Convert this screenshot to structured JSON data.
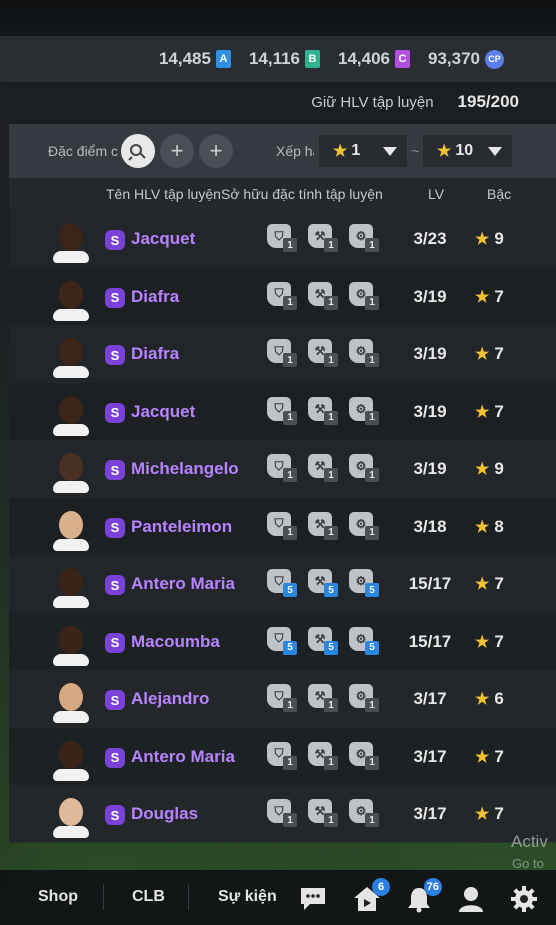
{
  "currencies": [
    {
      "value": "14,485",
      "letter": "A",
      "color": "#2f8fe0"
    },
    {
      "value": "14,116",
      "letter": "B",
      "color": "#2db38f"
    },
    {
      "value": "14,406",
      "letter": "C",
      "color": "#b14fe0"
    },
    {
      "value": "93,370",
      "letter": "CP",
      "color": "#5a7fe8"
    }
  ],
  "keep": {
    "label": "Giữ HLV tập luyện",
    "value": "195/200"
  },
  "filter": {
    "trait_label": "Đặc điểm c",
    "sort_label": "Xếp hạ",
    "min_star": "1",
    "max_star": "10",
    "add_glyph": "+"
  },
  "columns": {
    "name": "Tên HLV tập luyện",
    "traits": "Sở hữu đặc tính tập luyện",
    "lv": "LV",
    "grade": "Bậc"
  },
  "coaches": [
    {
      "name": "Jacquet",
      "lv": "3/23",
      "grade": "9",
      "skin": "#3b2418",
      "trait_levels": [
        "1",
        "1",
        "1"
      ],
      "blue": false
    },
    {
      "name": "Diafra",
      "lv": "3/19",
      "grade": "7",
      "skin": "#3d2519",
      "trait_levels": [
        "1",
        "1",
        "1"
      ],
      "blue": false
    },
    {
      "name": "Diafra",
      "lv": "3/19",
      "grade": "7",
      "skin": "#3d2519",
      "trait_levels": [
        "1",
        "1",
        "1"
      ],
      "blue": false
    },
    {
      "name": "Jacquet",
      "lv": "3/19",
      "grade": "7",
      "skin": "#3b2418",
      "trait_levels": [
        "1",
        "1",
        "1"
      ],
      "blue": false
    },
    {
      "name": "Michelangelo",
      "lv": "3/19",
      "grade": "9",
      "skin": "#4a3022",
      "trait_levels": [
        "1",
        "1",
        "1"
      ],
      "blue": false
    },
    {
      "name": "Panteleimon",
      "lv": "3/18",
      "grade": "8",
      "skin": "#d9b08c",
      "trait_levels": [
        "1",
        "1",
        "1"
      ],
      "blue": false
    },
    {
      "name": "Antero Maria",
      "lv": "15/17",
      "grade": "7",
      "skin": "#3a2418",
      "trait_levels": [
        "5",
        "5",
        "5"
      ],
      "blue": true
    },
    {
      "name": "Macoumba",
      "lv": "15/17",
      "grade": "7",
      "skin": "#3a2418",
      "trait_levels": [
        "5",
        "5",
        "5"
      ],
      "blue": true
    },
    {
      "name": "Alejandro",
      "lv": "3/17",
      "grade": "6",
      "skin": "#d6a882",
      "trait_levels": [
        "1",
        "1",
        "1"
      ],
      "blue": false
    },
    {
      "name": "Antero Maria",
      "lv": "3/17",
      "grade": "7",
      "skin": "#3a2418",
      "trait_levels": [
        "1",
        "1",
        "1"
      ],
      "blue": false
    },
    {
      "name": "Douglas",
      "lv": "3/17",
      "grade": "7",
      "skin": "#e0b89a",
      "trait_levels": [
        "1",
        "1",
        "1"
      ],
      "blue": false
    }
  ],
  "watermark": {
    "line1": "Activ",
    "line2": "Go to S"
  },
  "nav": {
    "shop": "Shop",
    "club": "CLB",
    "events": "Sự kiện",
    "home_badge": "6",
    "bell_badge": "76"
  }
}
